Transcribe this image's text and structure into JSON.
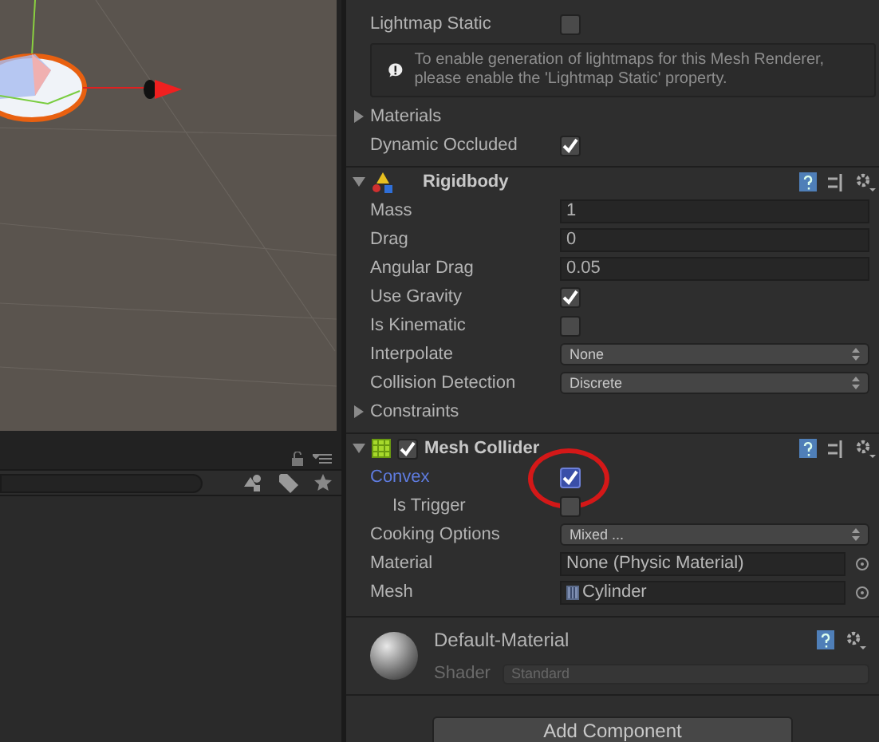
{
  "inspector": {
    "top_rows": [
      {
        "kind": "checkbox",
        "label": "Lightmap Static",
        "checked": false
      },
      {
        "kind": "info",
        "text": "To enable generation of lightmaps for this Mesh Renderer, please enable the 'Lightmap Static' property."
      },
      {
        "kind": "foldout",
        "label": "Materials",
        "expanded": false
      },
      {
        "kind": "checkbox",
        "label": "Dynamic Occluded",
        "checked": true
      }
    ],
    "components": [
      {
        "kind": "rigidbody",
        "name": "Rigidbody",
        "expanded": true,
        "rows": [
          {
            "kind": "text",
            "label": "Mass",
            "value": "1"
          },
          {
            "kind": "text",
            "label": "Drag",
            "value": "0"
          },
          {
            "kind": "text",
            "label": "Angular Drag",
            "value": "0.05"
          },
          {
            "kind": "checkbox",
            "label": "Use Gravity",
            "checked": true
          },
          {
            "kind": "checkbox",
            "label": "Is Kinematic",
            "checked": false
          },
          {
            "kind": "dropdown",
            "label": "Interpolate",
            "value": "None"
          },
          {
            "kind": "dropdown",
            "label": "Collision Detection",
            "value": "Discrete"
          },
          {
            "kind": "foldout",
            "label": "Constraints",
            "expanded": false
          }
        ]
      },
      {
        "kind": "collider",
        "name": "Mesh Collider",
        "expanded": true,
        "enabled": true,
        "rows": [
          {
            "kind": "checkbox",
            "label": "Convex",
            "checked": true,
            "focused": true,
            "highlighted": true
          },
          {
            "kind": "checkbox",
            "label": "Is Trigger",
            "checked": false,
            "indent": true
          },
          {
            "kind": "dropdown",
            "label": "Cooking Options",
            "value": "Mixed ..."
          },
          {
            "kind": "object",
            "label": "Material",
            "value": "None (Physic Material)"
          },
          {
            "kind": "object",
            "label": "Mesh",
            "value": "Cylinder",
            "asset": true
          }
        ]
      }
    ],
    "material": {
      "name": "Default-Material",
      "shader_label": "Shader",
      "shader": "Standard"
    },
    "add_button": "Add Component"
  }
}
